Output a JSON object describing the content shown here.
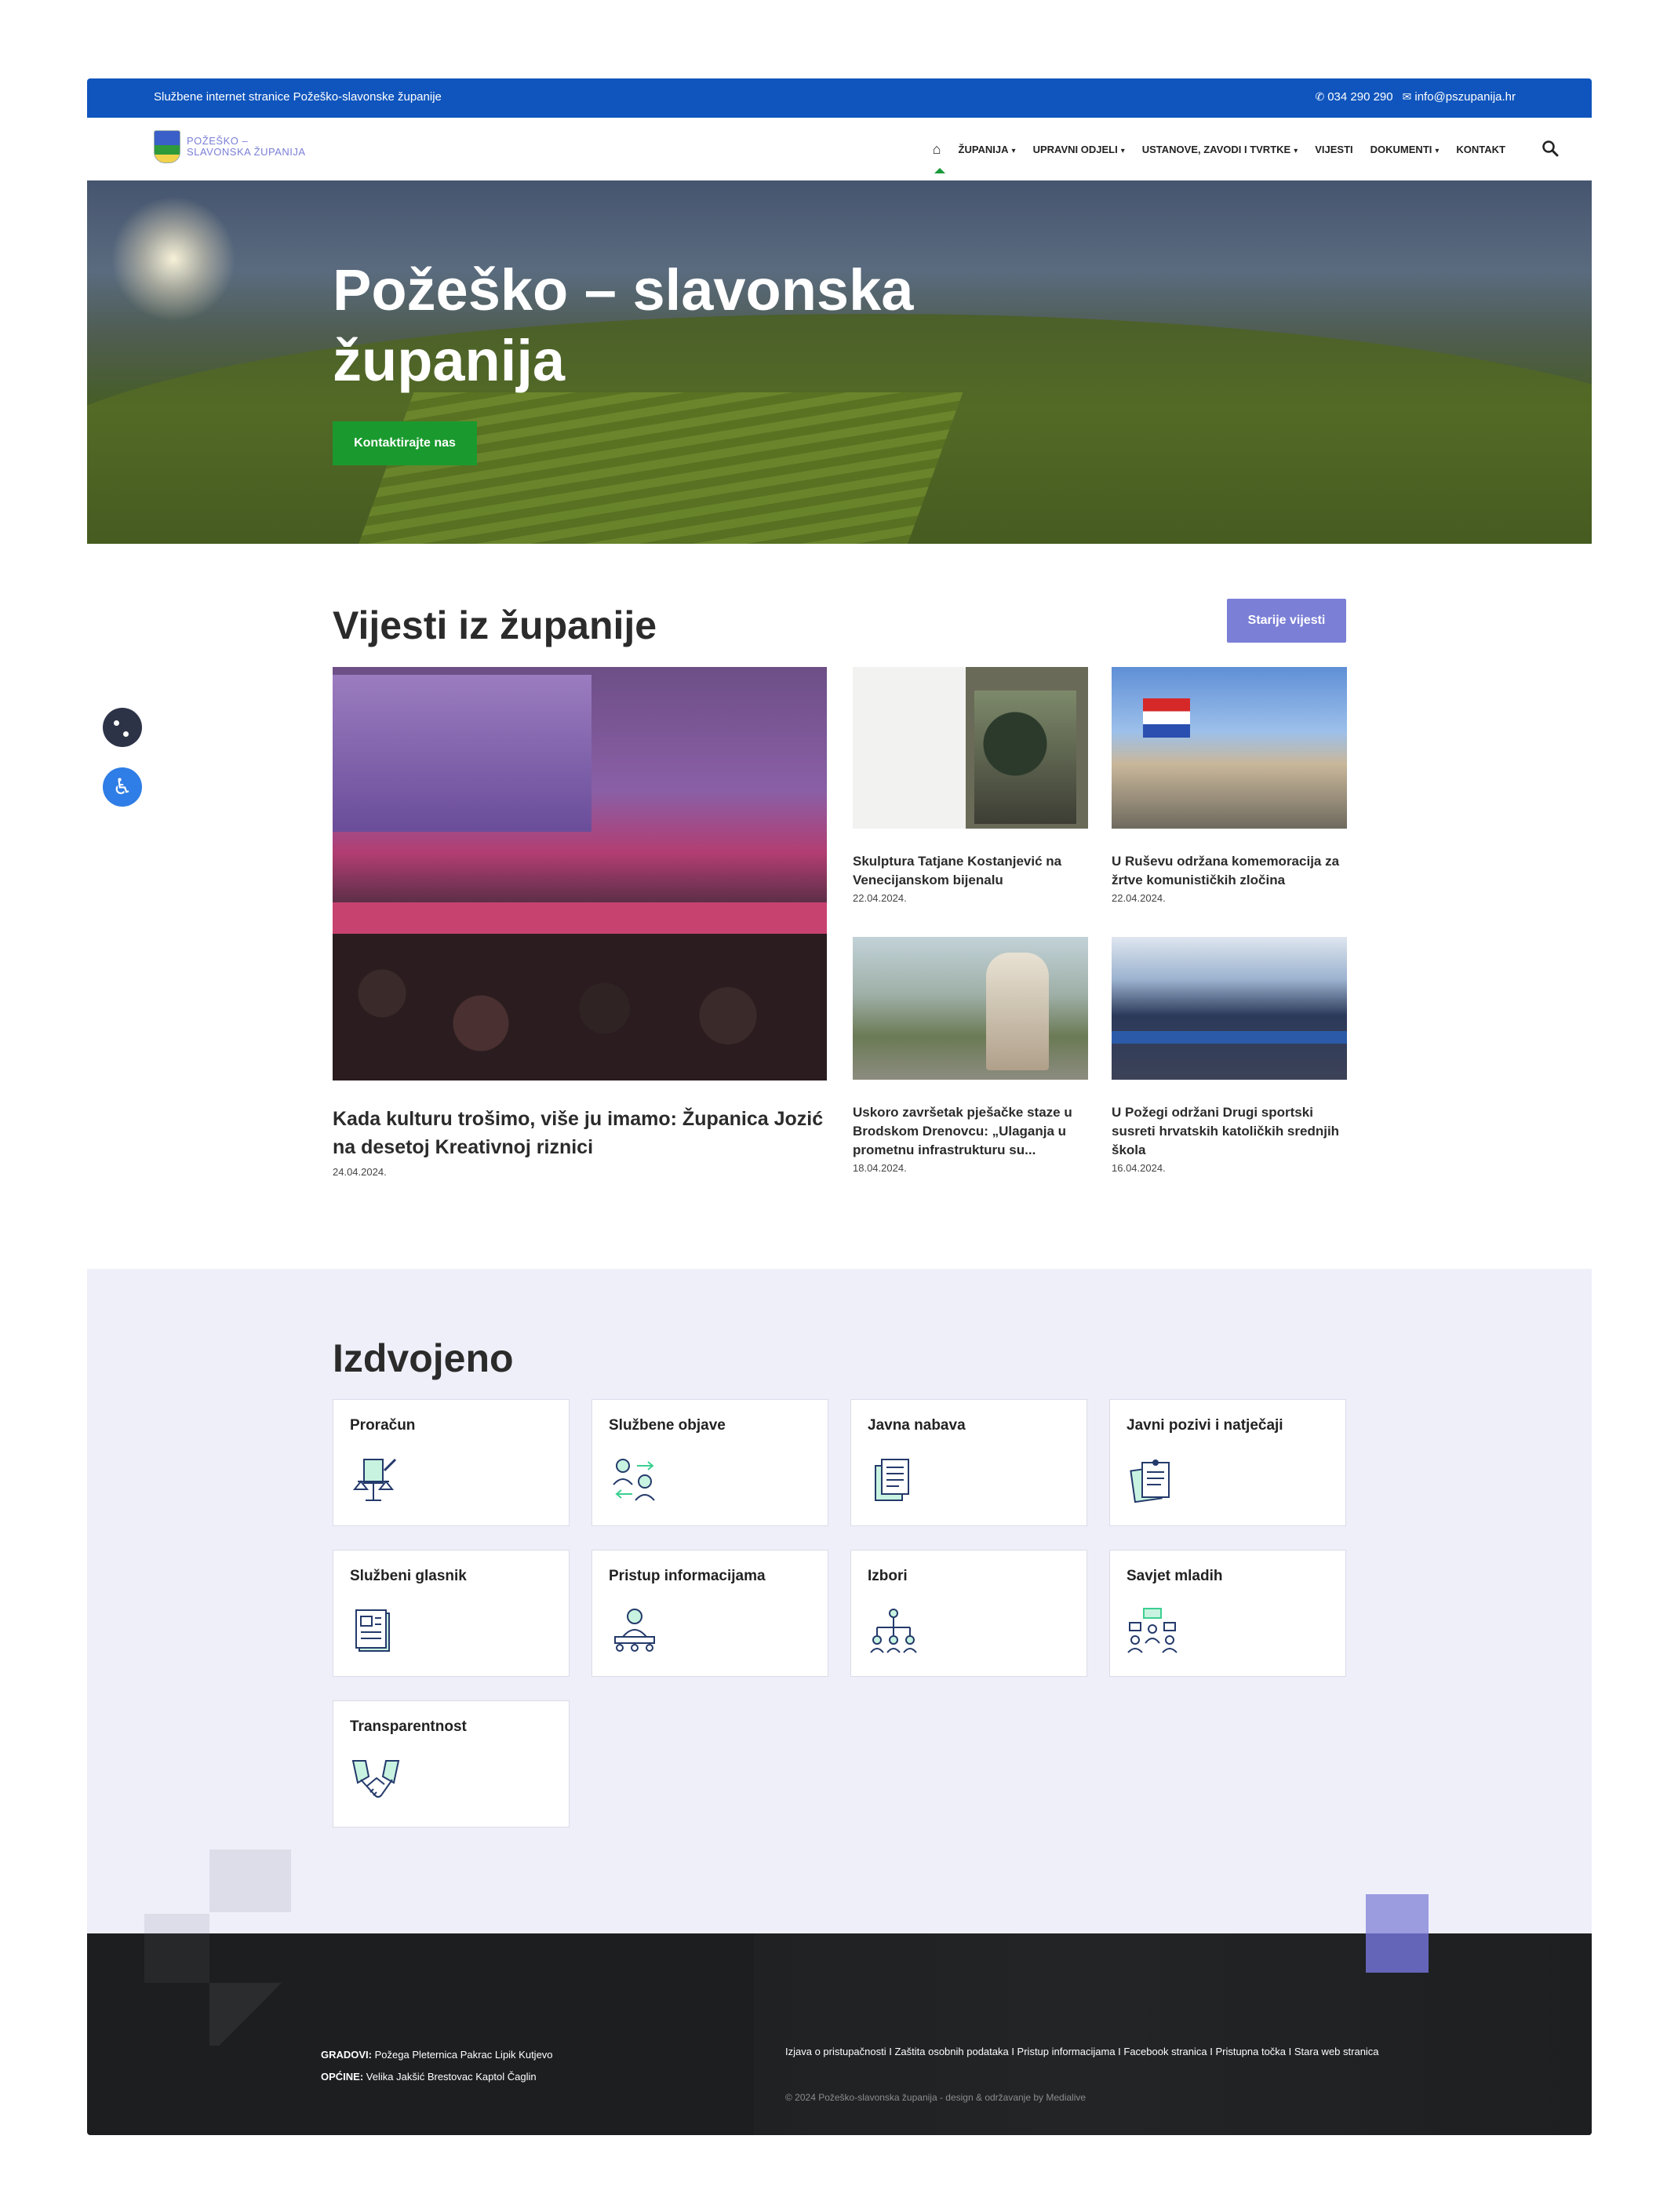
{
  "topbar": {
    "site_label": "Službene internet stranice Požeško-slavonske županije",
    "phone": "034 290 290",
    "email": "info@pszupanija.hr"
  },
  "logo": {
    "line1": "POŽEŠKO –",
    "line2": "SLAVONSKA ŽUPANIJA"
  },
  "nav": {
    "items": [
      {
        "label": "ŽUPANIJA",
        "dropdown": true
      },
      {
        "label": "UPRAVNI ODJELI",
        "dropdown": true
      },
      {
        "label": "USTANOVE, ZAVODI I TVRTKE",
        "dropdown": true
      },
      {
        "label": "VIJESTI",
        "dropdown": false
      },
      {
        "label": "DOKUMENTI",
        "dropdown": true
      },
      {
        "label": "KONTAKT",
        "dropdown": false
      }
    ]
  },
  "hero": {
    "title": "Požeško – slavonska županija",
    "cta": "Kontaktirajte nas"
  },
  "news": {
    "heading": "Vijesti iz županije",
    "older_button": "Starije vijesti",
    "main": {
      "title": "Kada kulturu trošimo, više ju imamo: Županica Jozić na desetoj Kreativnoj riznici",
      "date": "24.04.2024."
    },
    "items": [
      {
        "title": "Skulptura Tatjane Kostanjević na Venecijanskom bijenalu",
        "date": "22.04.2024."
      },
      {
        "title": "U Ruševu održana komemoracija za žrtve komunističkih zločina",
        "date": "22.04.2024."
      },
      {
        "title": "Uskoro završetak pješačke staze u Brodskom Drenovcu: „Ulaganja u prometnu infrastrukturu su...",
        "date": "18.04.2024."
      },
      {
        "title": "U Požegi održani Drugi sportski susreti hrvatskih katoličkih srednjih škola",
        "date": "16.04.2024."
      }
    ]
  },
  "featured": {
    "heading": "Izdvojeno",
    "items": [
      {
        "label": "Proračun",
        "icon": "budget-icon"
      },
      {
        "label": "Službene objave",
        "icon": "official-announcements-icon"
      },
      {
        "label": "Javna nabava",
        "icon": "public-procurement-icon"
      },
      {
        "label": "Javni pozivi i natječaji",
        "icon": "public-calls-icon"
      },
      {
        "label": "Službeni glasnik",
        "icon": "official-gazette-icon"
      },
      {
        "label": "Pristup informacijama",
        "icon": "access-information-icon"
      },
      {
        "label": "Izbori",
        "icon": "elections-icon"
      },
      {
        "label": "Savjet mladih",
        "icon": "youth-council-icon"
      },
      {
        "label": "Transparentnost",
        "icon": "transparency-icon"
      }
    ]
  },
  "footer": {
    "gradovi_label": "GRADOVI:",
    "gradovi": "Požega Pleternica Pakrac Lipik  Kutjevo",
    "opcine_label": "OPĆINE:",
    "opcine": "Velika Jakšić Brestovac Kaptol Čaglin",
    "links": "Izjava o pristupačnosti I Zaštita osobnih podataka I Pristup informacijama I Facebook stranica I Pristupna točka I Stara web stranica",
    "copyright": "© 2024 Požeško-slavonska županija - design & održavanje by Medialive"
  },
  "colors": {
    "topbar": "#0f55bd",
    "accent_green": "#1a9a2e",
    "accent_purple": "#7b7fd6",
    "footer": "#1c1e20",
    "featured_bg": "#efeffa"
  }
}
